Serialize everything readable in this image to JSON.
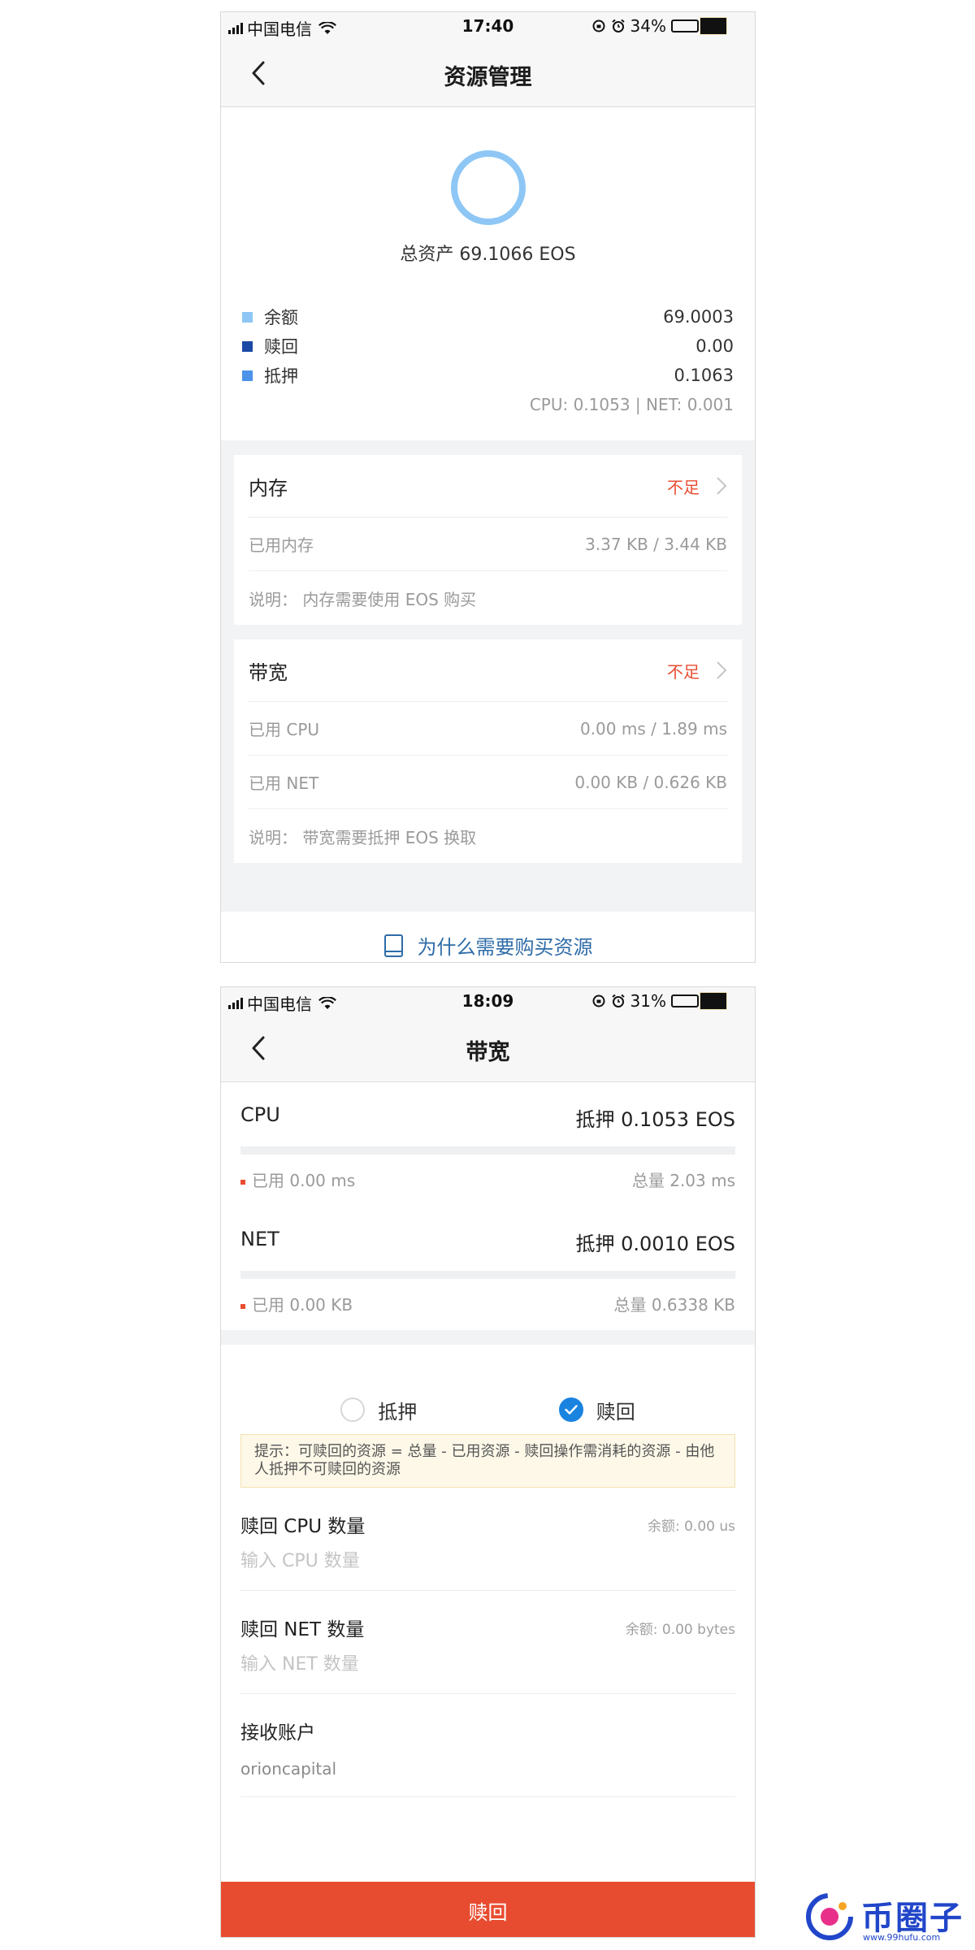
{
  "status_bar_1": {
    "carrier": "中国电信",
    "time": "17:40",
    "battery": "34%",
    "battery_level": 0.34
  },
  "status_bar_2": {
    "carrier": "中国电信",
    "time": "18:09",
    "battery": "31%",
    "battery_level": 0.31
  },
  "resource_screen": {
    "title": "资源管理",
    "total": "总资产 69.1066 EOS",
    "legend": [
      {
        "label": "余额",
        "value": "69.0003",
        "color": "#8ec7f5"
      },
      {
        "label": "赎回",
        "value": "0.00",
        "color": "#1b4aa6"
      },
      {
        "label": "抵押",
        "value": "0.1063",
        "color": "#4a93e8"
      }
    ],
    "breakdown": "CPU: 0.1053 | NET: 0.001",
    "memory": {
      "title": "内存",
      "status": "不足",
      "used_label": "已用内存",
      "used_value": "3.37 KB / 3.44 KB",
      "note": "说明： 内存需要使用 EOS 购买"
    },
    "bandwidth": {
      "title": "带宽",
      "status": "不足",
      "cpu_label": "已用 CPU",
      "cpu_value": "0.00 ms / 1.89 ms",
      "net_label": "已用 NET",
      "net_value": "0.00 KB / 0.626 KB",
      "note": "说明： 带宽需要抵押 EOS 换取"
    },
    "help_link": "为什么需要购买资源"
  },
  "bandwidth_screen": {
    "title": "带宽",
    "cpu": {
      "name": "CPU",
      "staked": "抵押 0.1053 EOS",
      "used": "已用 0.00 ms",
      "total": "总量 2.03 ms",
      "used_fraction": 0
    },
    "net": {
      "name": "NET",
      "staked": "抵押 0.0010 EOS",
      "used": "已用 0.00 KB",
      "total": "总量 0.6338 KB",
      "used_fraction": 0
    },
    "options": [
      {
        "label": "抵押",
        "checked": false
      },
      {
        "label": "赎回",
        "checked": true
      }
    ],
    "tip": "提示：可赎回的资源 = 总量 - 已用资源 - 赎回操作需消耗的资源 - 由他人抵押不可赎回的资源",
    "cpu_field": {
      "label": "赎回 CPU 数量",
      "hint": "余额: 0.00 us",
      "placeholder": "输入 CPU 数量"
    },
    "net_field": {
      "label": "赎回 NET 数量",
      "hint": "余额: 0.00 bytes",
      "placeholder": "输入 NET 数量"
    },
    "account_field": {
      "label": "接收账户",
      "value": "orioncapital"
    },
    "submit_label": "赎回"
  },
  "watermark": {
    "brand": "币圈子",
    "url": "www.99hufu.com"
  }
}
